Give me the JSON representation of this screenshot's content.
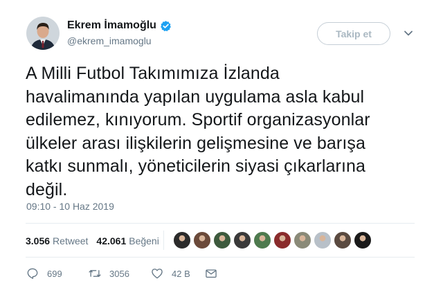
{
  "author": {
    "display_name": "Ekrem İmamoğlu",
    "handle": "@ekrem_imamoglu",
    "verified": true
  },
  "follow_button": {
    "label": "Takip et"
  },
  "tweet": {
    "text": "A Milli Futbol Takımımıza İzlanda\nhavalimanında yapılan uygulama asla kabul\nedilemez, kınıyorum. Sportif organizasyonlar\nülkeler arası ilişkilerin gelişmesine ve barışa\nkatkı sunmalı, yöneticilerin siyasi çıkarlarına\ndeğil.",
    "timestamp": "09:10 - 10 Haz 2019"
  },
  "stats": {
    "retweets_count": "3.056",
    "retweets_label": "Retweet",
    "likes_count": "42.061",
    "likes_label": "Beğeni"
  },
  "likers": [
    {
      "color": "#2b2b2b"
    },
    {
      "color": "#6b4a3a"
    },
    {
      "color": "#3d5a3d"
    },
    {
      "color": "#3a3a3a"
    },
    {
      "color": "#4e7a4e"
    },
    {
      "color": "#8a2c2c"
    },
    {
      "color": "#8a8a78"
    },
    {
      "color": "#b8c0c8"
    },
    {
      "color": "#5a4a40"
    },
    {
      "color": "#1a1a1a"
    }
  ],
  "actions": {
    "replies": "699",
    "retweets": "3056",
    "likes": "42 B"
  },
  "colors": {
    "verified_blue": "#1da1f2",
    "text": "#14171a",
    "secondary": "#657786"
  }
}
